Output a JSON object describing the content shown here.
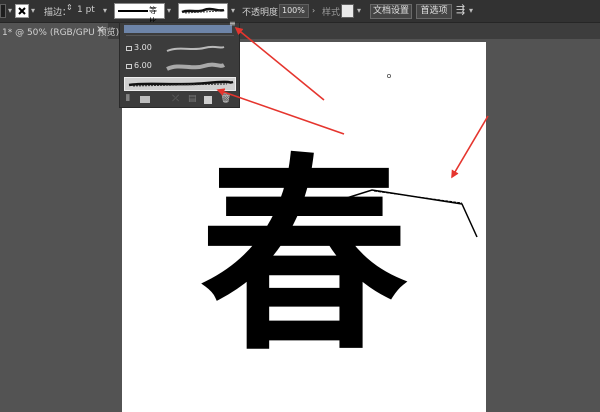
{
  "control_bar": {
    "stroke_label": "描边：",
    "stroke_weight": "1 pt",
    "stroke_profile_label": "等比",
    "opacity_label": "不透明度：",
    "opacity_value": "100%",
    "style_label": "样式：",
    "doc_setup_button": "文档设置",
    "preferences_button": "首选项"
  },
  "document_tab": {
    "label": "1* @ 50% (RGB/GPU 预览)",
    "close_glyph": "×"
  },
  "brush_panel": {
    "brushes": [
      {
        "size": "3.00"
      },
      {
        "size": "6.00"
      },
      {
        "size": ""
      }
    ]
  },
  "canvas": {
    "calligraphy_text": "春"
  },
  "colors": {
    "ui_dark": "#323232",
    "workspace": "#535353",
    "annotation_arrow": "#e5352e"
  }
}
